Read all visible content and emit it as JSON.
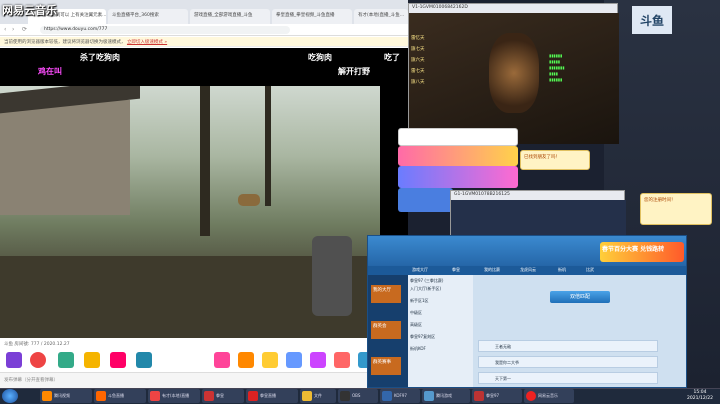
{
  "overlay_text": "网易云音乐",
  "browser": {
    "tabs": [
      {
        "label": "1 白中间 翻到可以 上有关注翼元素..."
      },
      {
        "label": "斗鱼直播平台_360搜索"
      },
      {
        "label": "游戏直播_全部游戏直播_斗鱼"
      },
      {
        "label": "拳皇直播_拳皇视频_斗鱼直播"
      },
      {
        "label": "有才(本地)直播_斗鱼..."
      }
    ],
    "url": "https://www.douyu.com/777",
    "notice_text": "当前使用的浏览器版本较低，建议将浏览器切换为极速模式，",
    "notice_link": "立即切入极速模式 »",
    "danmu": [
      {
        "text": "杀了吃狗肉"
      },
      {
        "text": "吃狗肉"
      },
      {
        "text": "吃了"
      },
      {
        "text": "鸡在叫"
      },
      {
        "text": "解开打野"
      }
    ],
    "footer_left": "斗鱼 房间號: 777 / 2020.12.27",
    "chat_placeholder": "发布弹幕（分开查看弹幕）"
  },
  "game_window_1": {
    "title": "V1-1GVM01006842162D",
    "players": [
      {
        "name": "雷忆天"
      },
      {
        "name": "旗七天"
      },
      {
        "name": "旗六天"
      },
      {
        "name": "雷七天"
      },
      {
        "name": "旗八天"
      }
    ]
  },
  "game_window_2": {
    "title": "G1-1GVM01078B216125"
  },
  "popup_1": {
    "text": "已找到朋友了吗！"
  },
  "popup_2": {
    "text": "您的注册时间！"
  },
  "lobby": {
    "banner": "春节百分大赛 兑钱路转",
    "tabs": [
      {
        "label": "游戏大厅"
      },
      {
        "label": "拳皇"
      },
      {
        "label": "我的比赛"
      },
      {
        "label": "龙虎风云"
      },
      {
        "label": "街机"
      },
      {
        "label": "比武"
      }
    ],
    "left_menu": [
      {
        "label": "我的大厅"
      },
      {
        "label": "群英会"
      },
      {
        "label": "群英赛事"
      }
    ],
    "rooms": [
      {
        "label": "拳皇97 (三拳比赛)"
      },
      {
        "label": "入门大厅(新手区)"
      },
      {
        "label": "新手区1区"
      },
      {
        "label": "中级区"
      },
      {
        "label": "高级区"
      },
      {
        "label": "拳皇97复刻区"
      },
      {
        "label": "街机KOF"
      }
    ],
    "match_button": "双倍匹配",
    "players": [
      {
        "name": "王者无敌"
      },
      {
        "name": "我是你二大爷"
      },
      {
        "name": "天下第一"
      }
    ]
  },
  "taskbar": {
    "items": [
      {
        "label": "腾讯视频"
      },
      {
        "label": "斗鱼直播"
      },
      {
        "label": "有才(本地)直播"
      },
      {
        "label": "拳皇"
      },
      {
        "label": "拳皇直播"
      },
      {
        "label": "文件"
      },
      {
        "label": "OBS"
      },
      {
        "label": "KOF97"
      },
      {
        "label": "腾讯游戏"
      },
      {
        "label": "拳皇97"
      },
      {
        "label": "网易云音乐"
      }
    ],
    "time": "15:04",
    "date": "2021/12/22"
  },
  "colors": {
    "douyu_orange": "#ff7700",
    "lobby_blue": "#2a6fb2",
    "taskbar": "#1f2a3c"
  }
}
